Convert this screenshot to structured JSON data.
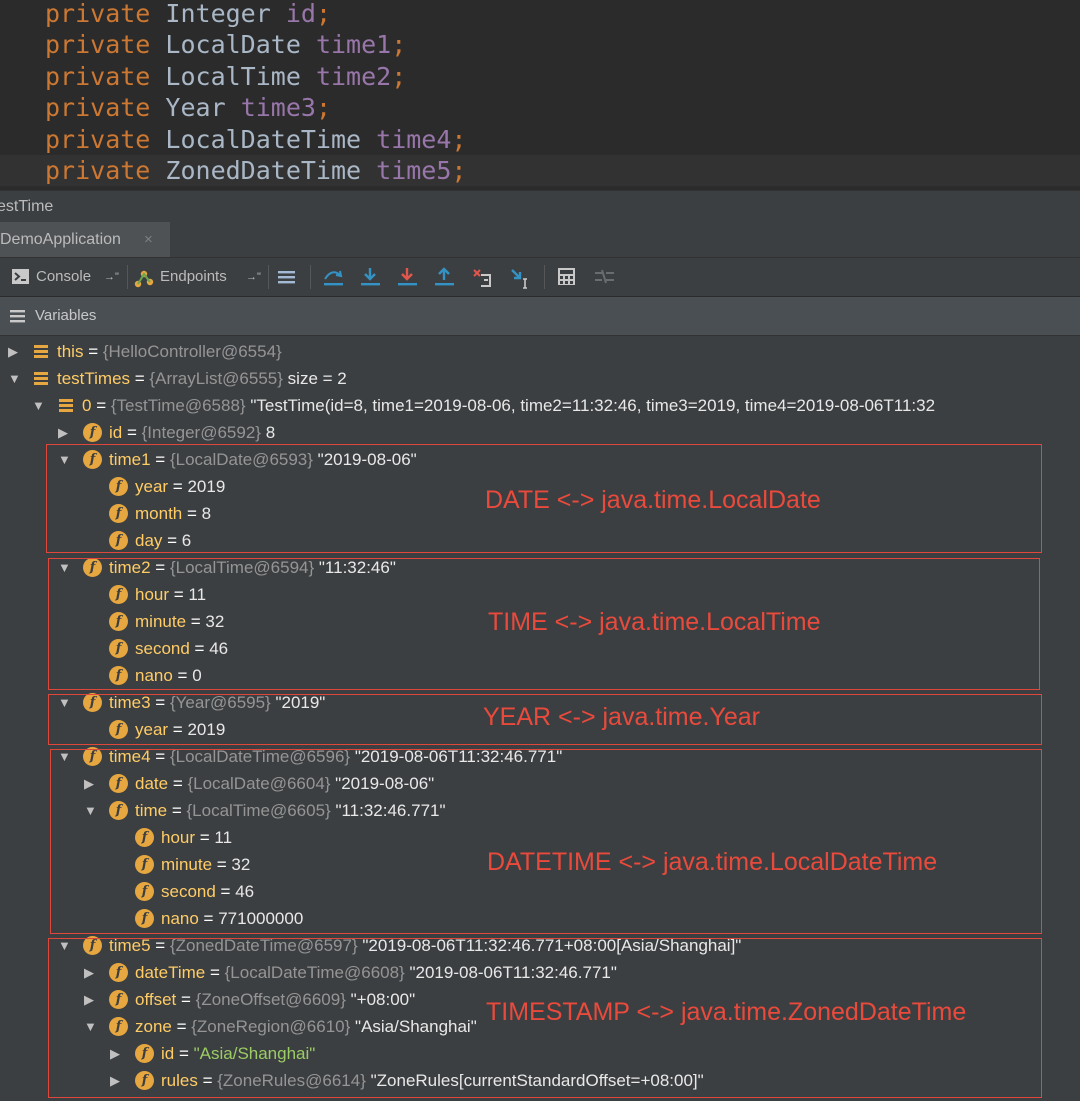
{
  "editor": {
    "lines": [
      {
        "keyword": "private",
        "type": "Integer",
        "field": "id",
        "semi": ";"
      },
      {
        "keyword": "private",
        "type": "LocalDate",
        "field": "time1",
        "semi": ";"
      },
      {
        "keyword": "private",
        "type": "LocalTime",
        "field": "time2",
        "semi": ";"
      },
      {
        "keyword": "private",
        "type": "Year",
        "field": "time3",
        "semi": ";"
      },
      {
        "keyword": "private",
        "type": "LocalDateTime",
        "field": "time4",
        "semi": ";"
      },
      {
        "keyword": "private",
        "type": "ZonedDateTime",
        "field": "time5",
        "semi": ";"
      }
    ]
  },
  "session": {
    "label": "estTime"
  },
  "run_tab": {
    "label": "DemoApplication",
    "close": "×"
  },
  "toolbar": {
    "console": "Console",
    "endpoints": "Endpoints",
    "pin": "→\""
  },
  "variables_header": {
    "label": "Variables"
  },
  "tree": [
    {
      "name": "this",
      "sep": " = ",
      "type": "{HelloController@6554}",
      "value": ""
    },
    {
      "name": "testTimes",
      "sep": " = ",
      "type": "{ArrayList@6555}",
      "value": "  size = 2"
    },
    {
      "name": "0",
      "sep": " = ",
      "type": "{TestTime@6588}",
      "value": " \"TestTime(id=8, time1=2019-08-06, time2=11:32:46, time3=2019, time4=2019-08-06T11:32"
    },
    {
      "name": "id",
      "sep": " = ",
      "type": "{Integer@6592}",
      "value": " 8"
    },
    {
      "name": "time1",
      "sep": " = ",
      "type": "{LocalDate@6593}",
      "value": " \"2019-08-06\""
    },
    {
      "name": "year",
      "sep": " = ",
      "type": "",
      "value": "2019"
    },
    {
      "name": "month",
      "sep": " = ",
      "type": "",
      "value": "8"
    },
    {
      "name": "day",
      "sep": " = ",
      "type": "",
      "value": "6"
    },
    {
      "name": "time2",
      "sep": " = ",
      "type": "{LocalTime@6594}",
      "value": " \"11:32:46\""
    },
    {
      "name": "hour",
      "sep": " = ",
      "type": "",
      "value": "11"
    },
    {
      "name": "minute",
      "sep": " = ",
      "type": "",
      "value": "32"
    },
    {
      "name": "second",
      "sep": " = ",
      "type": "",
      "value": "46"
    },
    {
      "name": "nano",
      "sep": " = ",
      "type": "",
      "value": "0"
    },
    {
      "name": "time3",
      "sep": " = ",
      "type": "{Year@6595}",
      "value": " \"2019\""
    },
    {
      "name": "year",
      "sep": " = ",
      "type": "",
      "value": "2019"
    },
    {
      "name": "time4",
      "sep": " = ",
      "type": "{LocalDateTime@6596}",
      "value": " \"2019-08-06T11:32:46.771\""
    },
    {
      "name": "date",
      "sep": " = ",
      "type": "{LocalDate@6604}",
      "value": " \"2019-08-06\""
    },
    {
      "name": "time",
      "sep": " = ",
      "type": "{LocalTime@6605}",
      "value": " \"11:32:46.771\""
    },
    {
      "name": "hour",
      "sep": " = ",
      "type": "",
      "value": "11"
    },
    {
      "name": "minute",
      "sep": " = ",
      "type": "",
      "value": "32"
    },
    {
      "name": "second",
      "sep": " = ",
      "type": "",
      "value": "46"
    },
    {
      "name": "nano",
      "sep": " = ",
      "type": "",
      "value": "771000000"
    },
    {
      "name": "time5",
      "sep": " = ",
      "type": "{ZonedDateTime@6597}",
      "value": " \"2019-08-06T11:32:46.771+08:00[Asia/Shanghai]\""
    },
    {
      "name": "dateTime",
      "sep": " = ",
      "type": "{LocalDateTime@6608}",
      "value": " \"2019-08-06T11:32:46.771\""
    },
    {
      "name": "offset",
      "sep": " = ",
      "type": "{ZoneOffset@6609}",
      "value": " \"+08:00\""
    },
    {
      "name": "zone",
      "sep": " = ",
      "type": "{ZoneRegion@6610}",
      "value": " \"Asia/Shanghai\""
    },
    {
      "name": "id",
      "sep": " = ",
      "type": "",
      "value": "\"Asia/Shanghai\""
    },
    {
      "name": "rules",
      "sep": " = ",
      "type": "{ZoneRules@6614}",
      "value": " \"ZoneRules[currentStandardOffset=+08:00]\""
    }
  ],
  "annotations": [
    "DATE <-> java.time.LocalDate",
    "TIME <-> java.time.LocalTime",
    "YEAR <-> java.time.Year",
    "DATETIME <-> java.time.LocalDateTime",
    "TIMESTAMP <-> java.time.ZonedDateTime"
  ],
  "colors": {
    "annotation": "#ea4a3c",
    "keyword": "#cc7832",
    "field": "#9876aa",
    "field_icon": "#e6a640",
    "string_green": "#9ccc65"
  }
}
